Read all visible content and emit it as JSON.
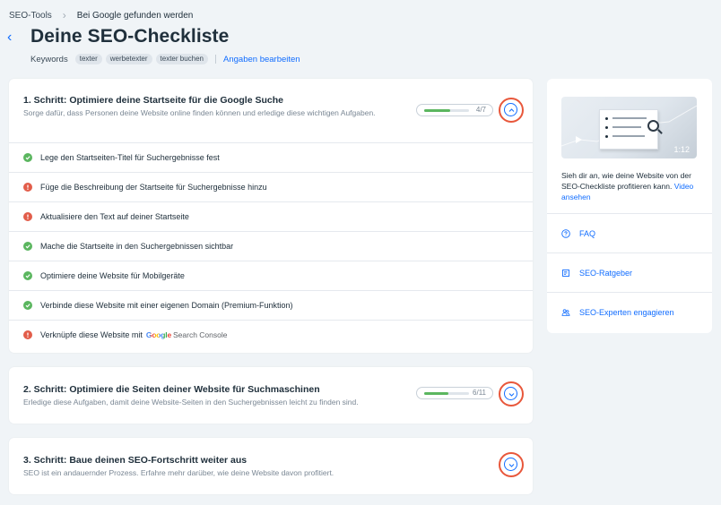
{
  "breadcrumb": {
    "root": "SEO-Tools",
    "current": "Bei Google gefunden werden"
  },
  "page": {
    "title": "Deine SEO-Checkliste"
  },
  "keywords": {
    "label": "Keywords",
    "tags": [
      "texter",
      "werbetexter",
      "texter buchen"
    ],
    "edit_label": "Angaben bearbeiten"
  },
  "steps": [
    {
      "title": "1. Schritt: Optimiere deine Startseite für die Google Suche",
      "subtitle": "Sorge dafür, dass Personen deine Website online finden können und erledige diese wichtigen Aufgaben.",
      "progress_label": "4/7",
      "progress": 0.571,
      "expanded": true,
      "tasks": [
        {
          "label": "Lege den Startseiten-Titel für Suchergebnisse fest",
          "status": "done"
        },
        {
          "label": "Füge die Beschreibung der Startseite für Suchergebnisse hinzu",
          "status": "todo"
        },
        {
          "label": "Aktualisiere den Text auf deiner Startseite",
          "status": "todo"
        },
        {
          "label": "Mache die Startseite in den Suchergebnissen sichtbar",
          "status": "done"
        },
        {
          "label": "Optimiere deine Website für Mobilgeräte",
          "status": "done"
        },
        {
          "label": "Verbinde diese Website mit einer eigenen Domain (Premium-Funktion)",
          "status": "done"
        },
        {
          "label": "Verknüpfe diese Website mit",
          "status": "todo",
          "logo_google": "Google",
          "logo_sc": "Search Console"
        }
      ]
    },
    {
      "title": "2. Schritt: Optimiere die Seiten deiner Website für Suchmaschinen",
      "subtitle": "Erledige diese Aufgaben, damit deine Website-Seiten in den Suchergebnissen leicht zu finden sind.",
      "progress_label": "6/11",
      "progress": 0.545,
      "expanded": false
    },
    {
      "title": "3. Schritt: Baue deinen SEO-Fortschritt weiter aus",
      "subtitle": "SEO ist ein andauernder Prozess. Erfahre mehr darüber, wie deine Website davon profitiert.",
      "expanded": false
    }
  ],
  "sidebar": {
    "video_duration": "1:12",
    "description": "Sieh dir an, wie deine Website von der SEO-Checkliste profitieren kann.",
    "video_link": "Video ansehen",
    "items": [
      {
        "label": "FAQ",
        "icon": "question-icon"
      },
      {
        "label": "SEO-Ratgeber",
        "icon": "book-icon"
      },
      {
        "label": "SEO-Experten engagieren",
        "icon": "people-icon"
      }
    ]
  },
  "colors": {
    "accent": "#116dff",
    "success": "#5bb65f",
    "warning": "#e25d4a",
    "highlight": "#e8573b"
  }
}
